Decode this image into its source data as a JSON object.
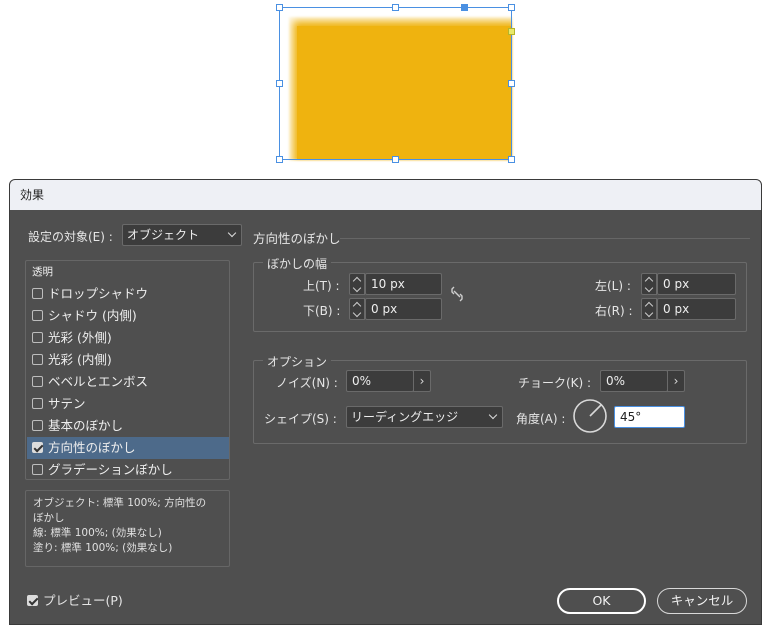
{
  "dialog": {
    "title": "効果",
    "target_label": "設定の対象(E) :",
    "target_value": "オブジェクト",
    "section_title": "方向性のぼかし"
  },
  "effects_list": {
    "header": "透明",
    "items": [
      {
        "label": "ドロップシャドウ",
        "checked": false
      },
      {
        "label": "シャドウ (内側)",
        "checked": false
      },
      {
        "label": "光彩 (外側)",
        "checked": false
      },
      {
        "label": "光彩 (内側)",
        "checked": false
      },
      {
        "label": "ベベルとエンボス",
        "checked": false
      },
      {
        "label": "サテン",
        "checked": false
      },
      {
        "label": "基本のぼかし",
        "checked": false
      },
      {
        "label": "方向性のぼかし",
        "checked": true,
        "selected": true
      },
      {
        "label": "グラデーションぼかし",
        "checked": false
      }
    ]
  },
  "summary": {
    "line1": "オブジェクト: 標準 100%; 方向性の",
    "line2": "ぼかし",
    "line3": "線: 標準 100%; (効果なし)",
    "line4": "塗り: 標準 100%; (効果なし)"
  },
  "feather_widths": {
    "group_title": "ぼかしの幅",
    "top_label": "上(T) :",
    "top_value": "10 px",
    "bottom_label": "下(B) :",
    "bottom_value": "0 px",
    "left_label": "左(L) :",
    "left_value": "0 px",
    "right_label": "右(R) :",
    "right_value": "0 px",
    "link_icon": "chain-link-broken-icon"
  },
  "options": {
    "group_title": "オプション",
    "noise_label": "ノイズ(N) :",
    "noise_value": "0%",
    "choke_label": "チョーク(K) :",
    "choke_value": "0%",
    "shape_label": "シェイプ(S) :",
    "shape_value": "リーディングエッジ",
    "angle_label": "角度(A) :",
    "angle_value": "45°"
  },
  "footer": {
    "preview_label": "プレビュー(P)",
    "preview_checked": true,
    "ok_label": "OK",
    "cancel_label": "キャンセル"
  },
  "colors": {
    "object_fill": "#efb30f",
    "selection": "#4a90e2",
    "dialog_bg": "#4f4f4f"
  }
}
